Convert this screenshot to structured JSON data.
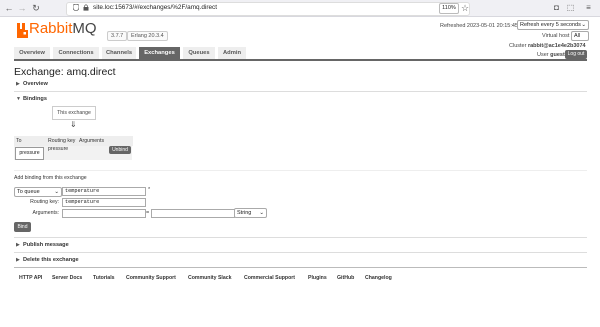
{
  "browser": {
    "url": "site.loc:15673/#/exchanges/%2F/amq.direct",
    "zoom": "110%"
  },
  "logo": {
    "rabbit": "Rabbit",
    "mq": "MQ"
  },
  "versions": {
    "rabbitmq": "3.7.7",
    "erlang": "Erlang 20.3.4"
  },
  "status": {
    "refreshed": "Refreshed 2023-05-01 20:15:45",
    "refresh_select": "Refresh every 5 seconds",
    "vhost_label": "Virtual host",
    "vhost_select": "All",
    "cluster_label": "Cluster",
    "cluster_name": "rabbit@ac1e4e2b3074",
    "user_label": "User",
    "user_name": "guest",
    "logout": "Log out"
  },
  "nav": {
    "tabs": [
      "Overview",
      "Connections",
      "Channels",
      "Exchanges",
      "Queues",
      "Admin"
    ],
    "active": "Exchanges"
  },
  "page": {
    "title": "Exchange: amq.direct",
    "overview": "Overview",
    "bindings": "Bindings"
  },
  "bindings": {
    "exchange_box": "This exchange",
    "arrow": "⇓",
    "headers": [
      "To",
      "Routing key",
      "Arguments"
    ],
    "row": {
      "to": "pressure",
      "routing_key": "pressure",
      "unbind": "Unbind"
    }
  },
  "add_binding": {
    "title": "Add binding from this exchange",
    "destination_type": "To queue",
    "destination_value": "temperature",
    "required_marker": "*",
    "routing_key_label": "Routing key:",
    "routing_key_value": "temperature",
    "arguments_label": "Arguments:",
    "arguments_key": "",
    "equals": "=",
    "arguments_value": "",
    "type_select": "String",
    "bind_button": "Bind"
  },
  "sections": {
    "publish": "Publish message",
    "delete": "Delete this exchange"
  },
  "footer": [
    "HTTP API",
    "Server Docs",
    "Tutorials",
    "Community Support",
    "Community Slack",
    "Commercial Support",
    "Plugins",
    "GitHub",
    "Changelog"
  ],
  "colors": {
    "brand": "#ff6600",
    "tab_active": "#666666",
    "button": "#666666"
  }
}
